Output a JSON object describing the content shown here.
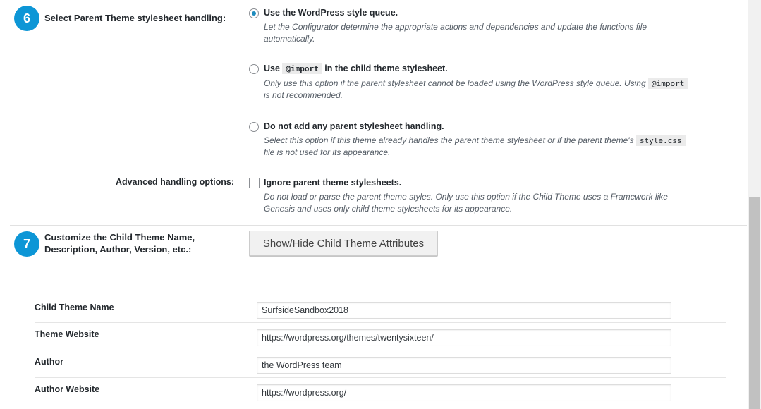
{
  "step6": {
    "number": "6",
    "label": "Select Parent Theme stylesheet handling:",
    "options": [
      {
        "label": "Use the WordPress style queue.",
        "desc": "Let the Configurator determine the appropriate actions and dependencies and update the functions file automatically.",
        "checked": true
      },
      {
        "label_pre": "Use",
        "label_code": "@import",
        "label_post": "in the child theme stylesheet.",
        "desc_pre": "Only use this option if the parent stylesheet cannot be loaded using the WordPress style queue. Using",
        "desc_code": "@import",
        "desc_post": "is not recommended.",
        "checked": false
      },
      {
        "label": "Do not add any parent stylesheet handling.",
        "desc_pre": "Select this option if this theme already handles the parent theme stylesheet or if the parent theme's",
        "desc_code": "style.css",
        "desc_post": "file is not used for its appearance.",
        "checked": false
      }
    ],
    "advanced_label": "Advanced handling options:",
    "advanced_option": {
      "label": "Ignore parent theme stylesheets.",
      "desc": "Do not load or parse the parent theme styles. Only use this option if the Child Theme uses a Framework like Genesis and uses only child theme stylesheets for its appearance.",
      "checked": false
    }
  },
  "step7": {
    "number": "7",
    "label": "Customize the Child Theme Name, Description, Author, Version, etc.:",
    "button_label": "Show/Hide Child Theme Attributes"
  },
  "fields": [
    {
      "label": "Child Theme Name",
      "value": "SurfsideSandbox2018"
    },
    {
      "label": "Theme Website",
      "value": "https://wordpress.org/themes/twentysixteen/"
    },
    {
      "label": "Author",
      "value": "the WordPress team"
    },
    {
      "label": "Author Website",
      "value": "https://wordpress.org/"
    }
  ],
  "colors": {
    "badge": "#0d96d6",
    "radio_checked": "#1e8cbe"
  }
}
